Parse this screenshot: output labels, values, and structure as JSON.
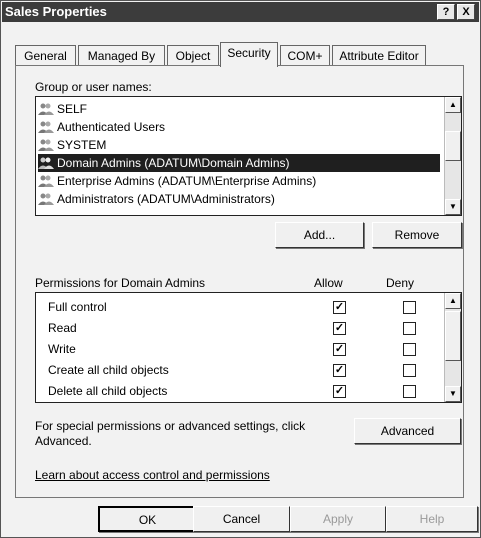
{
  "window": {
    "title": "Sales Properties",
    "help_btn": "?",
    "close_btn": "X"
  },
  "tabs": [
    {
      "label": "General"
    },
    {
      "label": "Managed By"
    },
    {
      "label": "Object"
    },
    {
      "label": "Security",
      "active": true
    },
    {
      "label": "COM+"
    },
    {
      "label": "Attribute Editor"
    }
  ],
  "groups": {
    "label": "Group or user names:",
    "items": [
      "SELF",
      "Authenticated Users",
      "SYSTEM",
      "Domain Admins (ADATUM\\Domain Admins)",
      "Enterprise Admins (ADATUM\\Enterprise Admins)",
      "Administrators (ADATUM\\Administrators)"
    ],
    "selected_index": 3,
    "add_label": "Add...",
    "remove_label": "Remove"
  },
  "permissions": {
    "label": "Permissions for Domain Admins",
    "allow_header": "Allow",
    "deny_header": "Deny",
    "rows": [
      {
        "name": "Full control",
        "allow": true,
        "deny": false
      },
      {
        "name": "Read",
        "allow": true,
        "deny": false
      },
      {
        "name": "Write",
        "allow": true,
        "deny": false
      },
      {
        "name": "Create all child objects",
        "allow": true,
        "deny": false
      },
      {
        "name": "Delete all child objects",
        "allow": true,
        "deny": false
      }
    ]
  },
  "advanced": {
    "text": "For special permissions or advanced settings, click Advanced.",
    "button": "Advanced"
  },
  "link": "Learn about access control and permissions",
  "footer": {
    "ok": "OK",
    "cancel": "Cancel",
    "apply": "Apply",
    "help": "Help"
  }
}
